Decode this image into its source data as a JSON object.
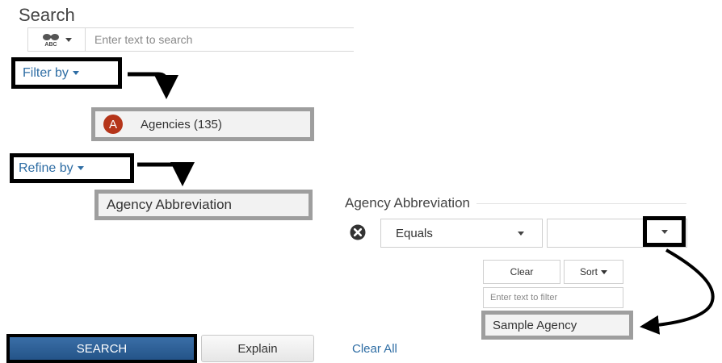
{
  "search": {
    "title": "Search",
    "type_icon": "abc-search-icon",
    "placeholder": "Enter text to search"
  },
  "filter": {
    "label": "Filter by",
    "item_letter": "A",
    "item_label": "Agencies (135)"
  },
  "refine": {
    "label": "Refine by",
    "item_label": "Agency Abbreviation"
  },
  "refine_panel": {
    "title": "Agency Abbreviation",
    "operator": "Equals",
    "value": "",
    "clear_label": "Clear",
    "sort_label": "Sort",
    "filter_placeholder": "Enter text to filter",
    "option": "Sample Agency"
  },
  "actions": {
    "search_label": "SEARCH",
    "explain_label": "Explain",
    "clear_all_label": "Clear All"
  },
  "colors": {
    "link": "#2e6da4",
    "search_button": "#2e5f96",
    "avatar": "#b5351a",
    "annotation_box": "#000000",
    "highlight_gray": "#9e9e9e"
  }
}
